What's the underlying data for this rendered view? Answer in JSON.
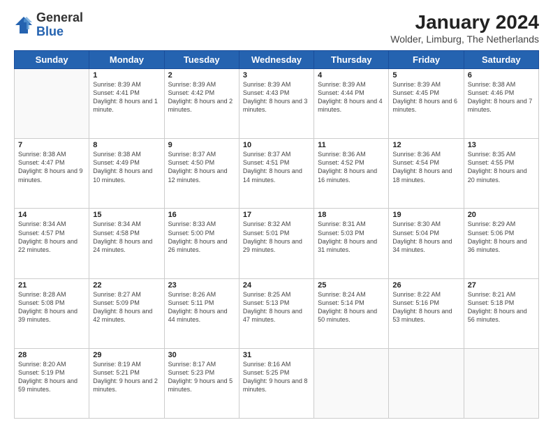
{
  "header": {
    "logo_general": "General",
    "logo_blue": "Blue",
    "month_year": "January 2024",
    "location": "Wolder, Limburg, The Netherlands"
  },
  "weekdays": [
    "Sunday",
    "Monday",
    "Tuesday",
    "Wednesday",
    "Thursday",
    "Friday",
    "Saturday"
  ],
  "weeks": [
    [
      {
        "num": "",
        "sunrise": "",
        "sunset": "",
        "daylight": ""
      },
      {
        "num": "1",
        "sunrise": "Sunrise: 8:39 AM",
        "sunset": "Sunset: 4:41 PM",
        "daylight": "Daylight: 8 hours and 1 minute."
      },
      {
        "num": "2",
        "sunrise": "Sunrise: 8:39 AM",
        "sunset": "Sunset: 4:42 PM",
        "daylight": "Daylight: 8 hours and 2 minutes."
      },
      {
        "num": "3",
        "sunrise": "Sunrise: 8:39 AM",
        "sunset": "Sunset: 4:43 PM",
        "daylight": "Daylight: 8 hours and 3 minutes."
      },
      {
        "num": "4",
        "sunrise": "Sunrise: 8:39 AM",
        "sunset": "Sunset: 4:44 PM",
        "daylight": "Daylight: 8 hours and 4 minutes."
      },
      {
        "num": "5",
        "sunrise": "Sunrise: 8:39 AM",
        "sunset": "Sunset: 4:45 PM",
        "daylight": "Daylight: 8 hours and 6 minutes."
      },
      {
        "num": "6",
        "sunrise": "Sunrise: 8:38 AM",
        "sunset": "Sunset: 4:46 PM",
        "daylight": "Daylight: 8 hours and 7 minutes."
      }
    ],
    [
      {
        "num": "7",
        "sunrise": "Sunrise: 8:38 AM",
        "sunset": "Sunset: 4:47 PM",
        "daylight": "Daylight: 8 hours and 9 minutes."
      },
      {
        "num": "8",
        "sunrise": "Sunrise: 8:38 AM",
        "sunset": "Sunset: 4:49 PM",
        "daylight": "Daylight: 8 hours and 10 minutes."
      },
      {
        "num": "9",
        "sunrise": "Sunrise: 8:37 AM",
        "sunset": "Sunset: 4:50 PM",
        "daylight": "Daylight: 8 hours and 12 minutes."
      },
      {
        "num": "10",
        "sunrise": "Sunrise: 8:37 AM",
        "sunset": "Sunset: 4:51 PM",
        "daylight": "Daylight: 8 hours and 14 minutes."
      },
      {
        "num": "11",
        "sunrise": "Sunrise: 8:36 AM",
        "sunset": "Sunset: 4:52 PM",
        "daylight": "Daylight: 8 hours and 16 minutes."
      },
      {
        "num": "12",
        "sunrise": "Sunrise: 8:36 AM",
        "sunset": "Sunset: 4:54 PM",
        "daylight": "Daylight: 8 hours and 18 minutes."
      },
      {
        "num": "13",
        "sunrise": "Sunrise: 8:35 AM",
        "sunset": "Sunset: 4:55 PM",
        "daylight": "Daylight: 8 hours and 20 minutes."
      }
    ],
    [
      {
        "num": "14",
        "sunrise": "Sunrise: 8:34 AM",
        "sunset": "Sunset: 4:57 PM",
        "daylight": "Daylight: 8 hours and 22 minutes."
      },
      {
        "num": "15",
        "sunrise": "Sunrise: 8:34 AM",
        "sunset": "Sunset: 4:58 PM",
        "daylight": "Daylight: 8 hours and 24 minutes."
      },
      {
        "num": "16",
        "sunrise": "Sunrise: 8:33 AM",
        "sunset": "Sunset: 5:00 PM",
        "daylight": "Daylight: 8 hours and 26 minutes."
      },
      {
        "num": "17",
        "sunrise": "Sunrise: 8:32 AM",
        "sunset": "Sunset: 5:01 PM",
        "daylight": "Daylight: 8 hours and 29 minutes."
      },
      {
        "num": "18",
        "sunrise": "Sunrise: 8:31 AM",
        "sunset": "Sunset: 5:03 PM",
        "daylight": "Daylight: 8 hours and 31 minutes."
      },
      {
        "num": "19",
        "sunrise": "Sunrise: 8:30 AM",
        "sunset": "Sunset: 5:04 PM",
        "daylight": "Daylight: 8 hours and 34 minutes."
      },
      {
        "num": "20",
        "sunrise": "Sunrise: 8:29 AM",
        "sunset": "Sunset: 5:06 PM",
        "daylight": "Daylight: 8 hours and 36 minutes."
      }
    ],
    [
      {
        "num": "21",
        "sunrise": "Sunrise: 8:28 AM",
        "sunset": "Sunset: 5:08 PM",
        "daylight": "Daylight: 8 hours and 39 minutes."
      },
      {
        "num": "22",
        "sunrise": "Sunrise: 8:27 AM",
        "sunset": "Sunset: 5:09 PM",
        "daylight": "Daylight: 8 hours and 42 minutes."
      },
      {
        "num": "23",
        "sunrise": "Sunrise: 8:26 AM",
        "sunset": "Sunset: 5:11 PM",
        "daylight": "Daylight: 8 hours and 44 minutes."
      },
      {
        "num": "24",
        "sunrise": "Sunrise: 8:25 AM",
        "sunset": "Sunset: 5:13 PM",
        "daylight": "Daylight: 8 hours and 47 minutes."
      },
      {
        "num": "25",
        "sunrise": "Sunrise: 8:24 AM",
        "sunset": "Sunset: 5:14 PM",
        "daylight": "Daylight: 8 hours and 50 minutes."
      },
      {
        "num": "26",
        "sunrise": "Sunrise: 8:22 AM",
        "sunset": "Sunset: 5:16 PM",
        "daylight": "Daylight: 8 hours and 53 minutes."
      },
      {
        "num": "27",
        "sunrise": "Sunrise: 8:21 AM",
        "sunset": "Sunset: 5:18 PM",
        "daylight": "Daylight: 8 hours and 56 minutes."
      }
    ],
    [
      {
        "num": "28",
        "sunrise": "Sunrise: 8:20 AM",
        "sunset": "Sunset: 5:19 PM",
        "daylight": "Daylight: 8 hours and 59 minutes."
      },
      {
        "num": "29",
        "sunrise": "Sunrise: 8:19 AM",
        "sunset": "Sunset: 5:21 PM",
        "daylight": "Daylight: 9 hours and 2 minutes."
      },
      {
        "num": "30",
        "sunrise": "Sunrise: 8:17 AM",
        "sunset": "Sunset: 5:23 PM",
        "daylight": "Daylight: 9 hours and 5 minutes."
      },
      {
        "num": "31",
        "sunrise": "Sunrise: 8:16 AM",
        "sunset": "Sunset: 5:25 PM",
        "daylight": "Daylight: 9 hours and 8 minutes."
      },
      {
        "num": "",
        "sunrise": "",
        "sunset": "",
        "daylight": ""
      },
      {
        "num": "",
        "sunrise": "",
        "sunset": "",
        "daylight": ""
      },
      {
        "num": "",
        "sunrise": "",
        "sunset": "",
        "daylight": ""
      }
    ]
  ]
}
